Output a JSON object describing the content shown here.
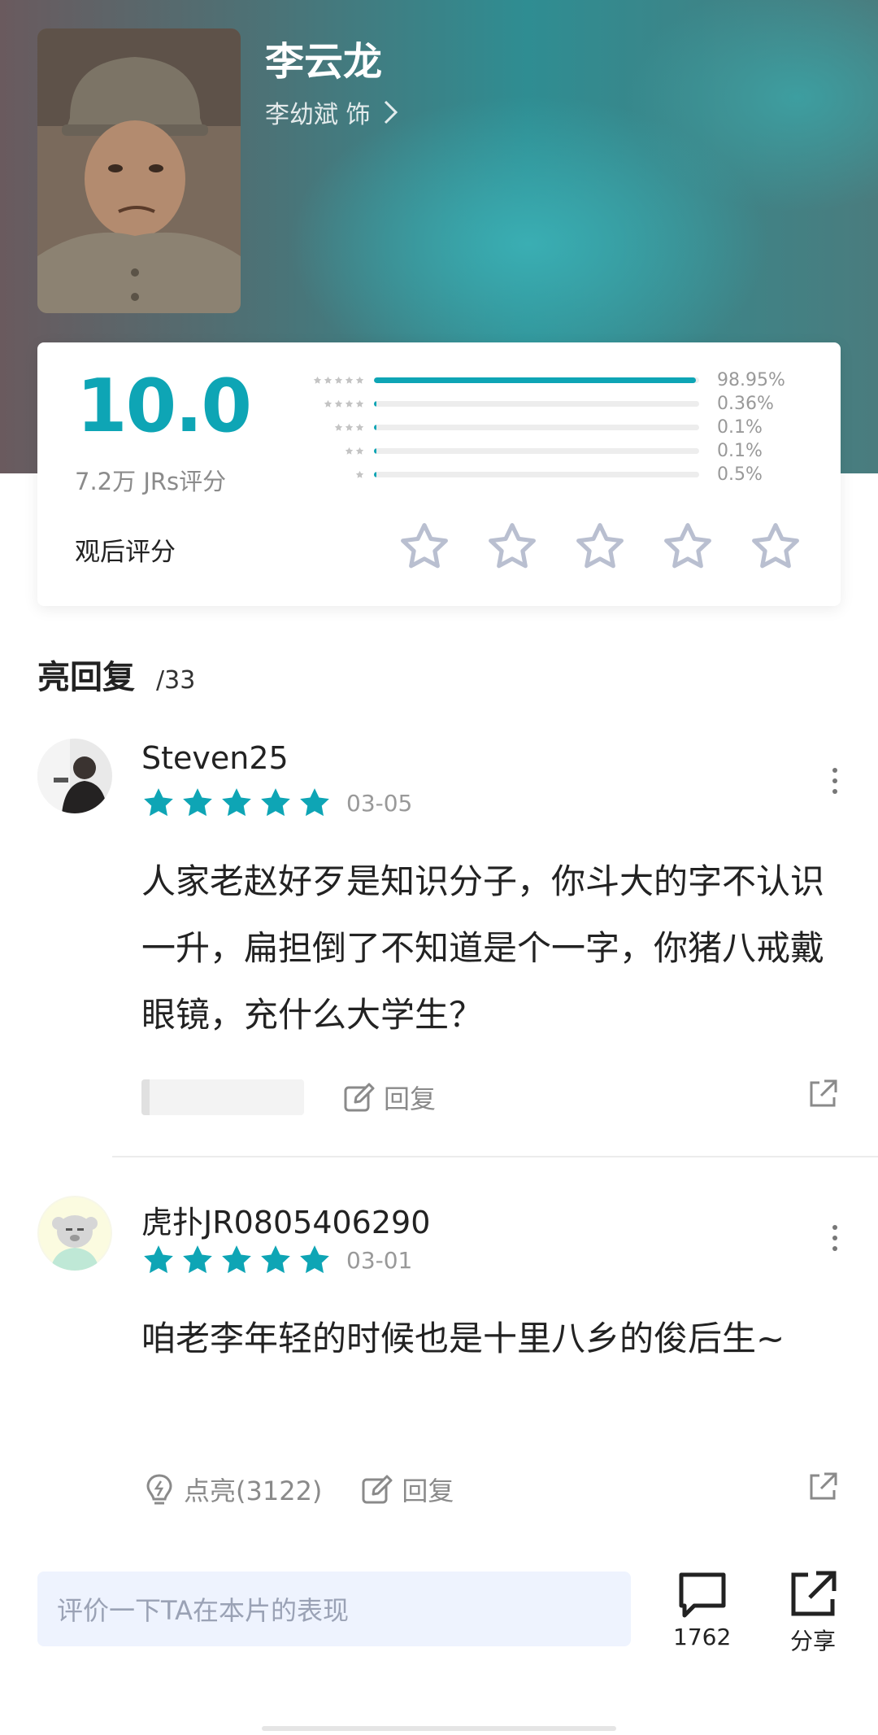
{
  "header": {
    "role_name": "李云龙",
    "actor_line": "李幼斌 饰"
  },
  "rating": {
    "score": "10.0",
    "count_text": "7.2万 JRs评分",
    "distribution": [
      {
        "stars": 5,
        "percent_text": "98.95%",
        "value": 98.95
      },
      {
        "stars": 4,
        "percent_text": "0.36%",
        "value": 0.36
      },
      {
        "stars": 3,
        "percent_text": "0.1%",
        "value": 0.1
      },
      {
        "stars": 2,
        "percent_text": "0.1%",
        "value": 0.1
      },
      {
        "stars": 1,
        "percent_text": "0.5%",
        "value": 0.5
      }
    ],
    "after_watch_label": "观后评分",
    "user_rating": 0,
    "accent_color": "#0ea5b5"
  },
  "section": {
    "title": "亮回复",
    "count": "/33"
  },
  "comments": [
    {
      "username": "Steven25",
      "stars": 5,
      "date": "03-05",
      "text": "人家老赵好歹是知识分子，你斗大的字不认识一升，扁担倒了不知道是个一字，你猪八戒戴眼镜，充什么大学生？",
      "reply_label": "回复"
    },
    {
      "username": "虎扑JR0805406290",
      "stars": 5,
      "date": "03-01",
      "text": "咱老李年轻的时候也是十里八乡的俊后生~",
      "like_label": "点亮(3122)",
      "reply_label": "回复"
    }
  ],
  "bottom_bar": {
    "input_placeholder": "评价一下TA在本片的表现",
    "comment_count": "1762",
    "share_label": "分享"
  }
}
